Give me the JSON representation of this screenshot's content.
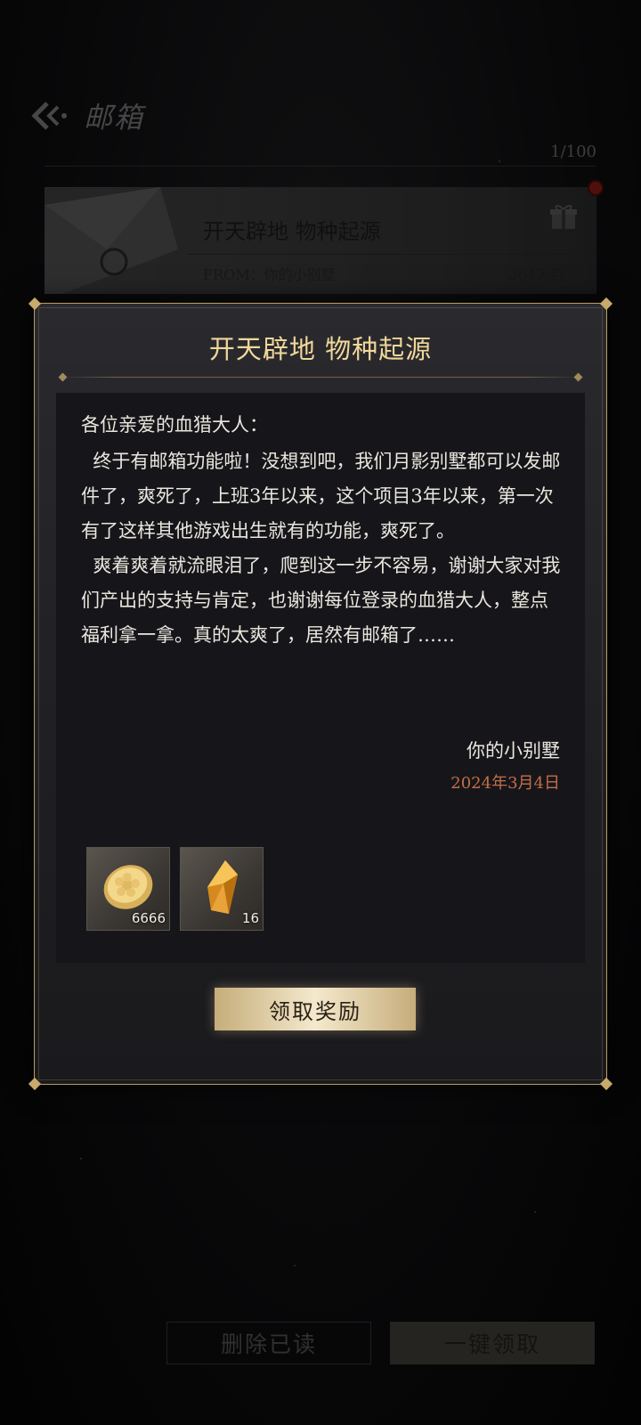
{
  "header": {
    "title": "邮箱",
    "back_icon": "back-arrow-icon"
  },
  "mailbox_count": "1/100",
  "mail_item": {
    "title": "开天辟地 物种起源",
    "from": "FROM：你的小别墅",
    "expires": "364天后",
    "icon": "gift-icon"
  },
  "modal": {
    "title": "开天辟地 物种起源",
    "greeting": "各位亲爱的血猎大人：",
    "body": "  终于有邮箱功能啦！没想到吧，我们月影别墅都可以发邮件了，爽死了，上班3年以来，这个项目3年以来，第一次有了这样其他游戏出生就有的功能，爽死了。\n  爽着爽着就流眼泪了，爬到这一步不容易，谢谢大家对我们产出的支持与肯定，也谢谢每位登录的血猎大人，整点福利拿一拿。真的太爽了，居然有邮箱了……",
    "signer": "你的小别墅",
    "date": "2024年3月4日",
    "rewards": [
      {
        "icon": "gold-coin-icon",
        "count": "6666"
      },
      {
        "icon": "amber-crystal-icon",
        "count": "16"
      }
    ],
    "claim_label": "领取奖励"
  },
  "footer": {
    "delete_read_label": "删除已读",
    "claim_all_label": "一键领取"
  },
  "colors": {
    "accent_gold": "#f0d79a",
    "date_orange": "#c46e48",
    "frame_gold": "#b99d62"
  }
}
